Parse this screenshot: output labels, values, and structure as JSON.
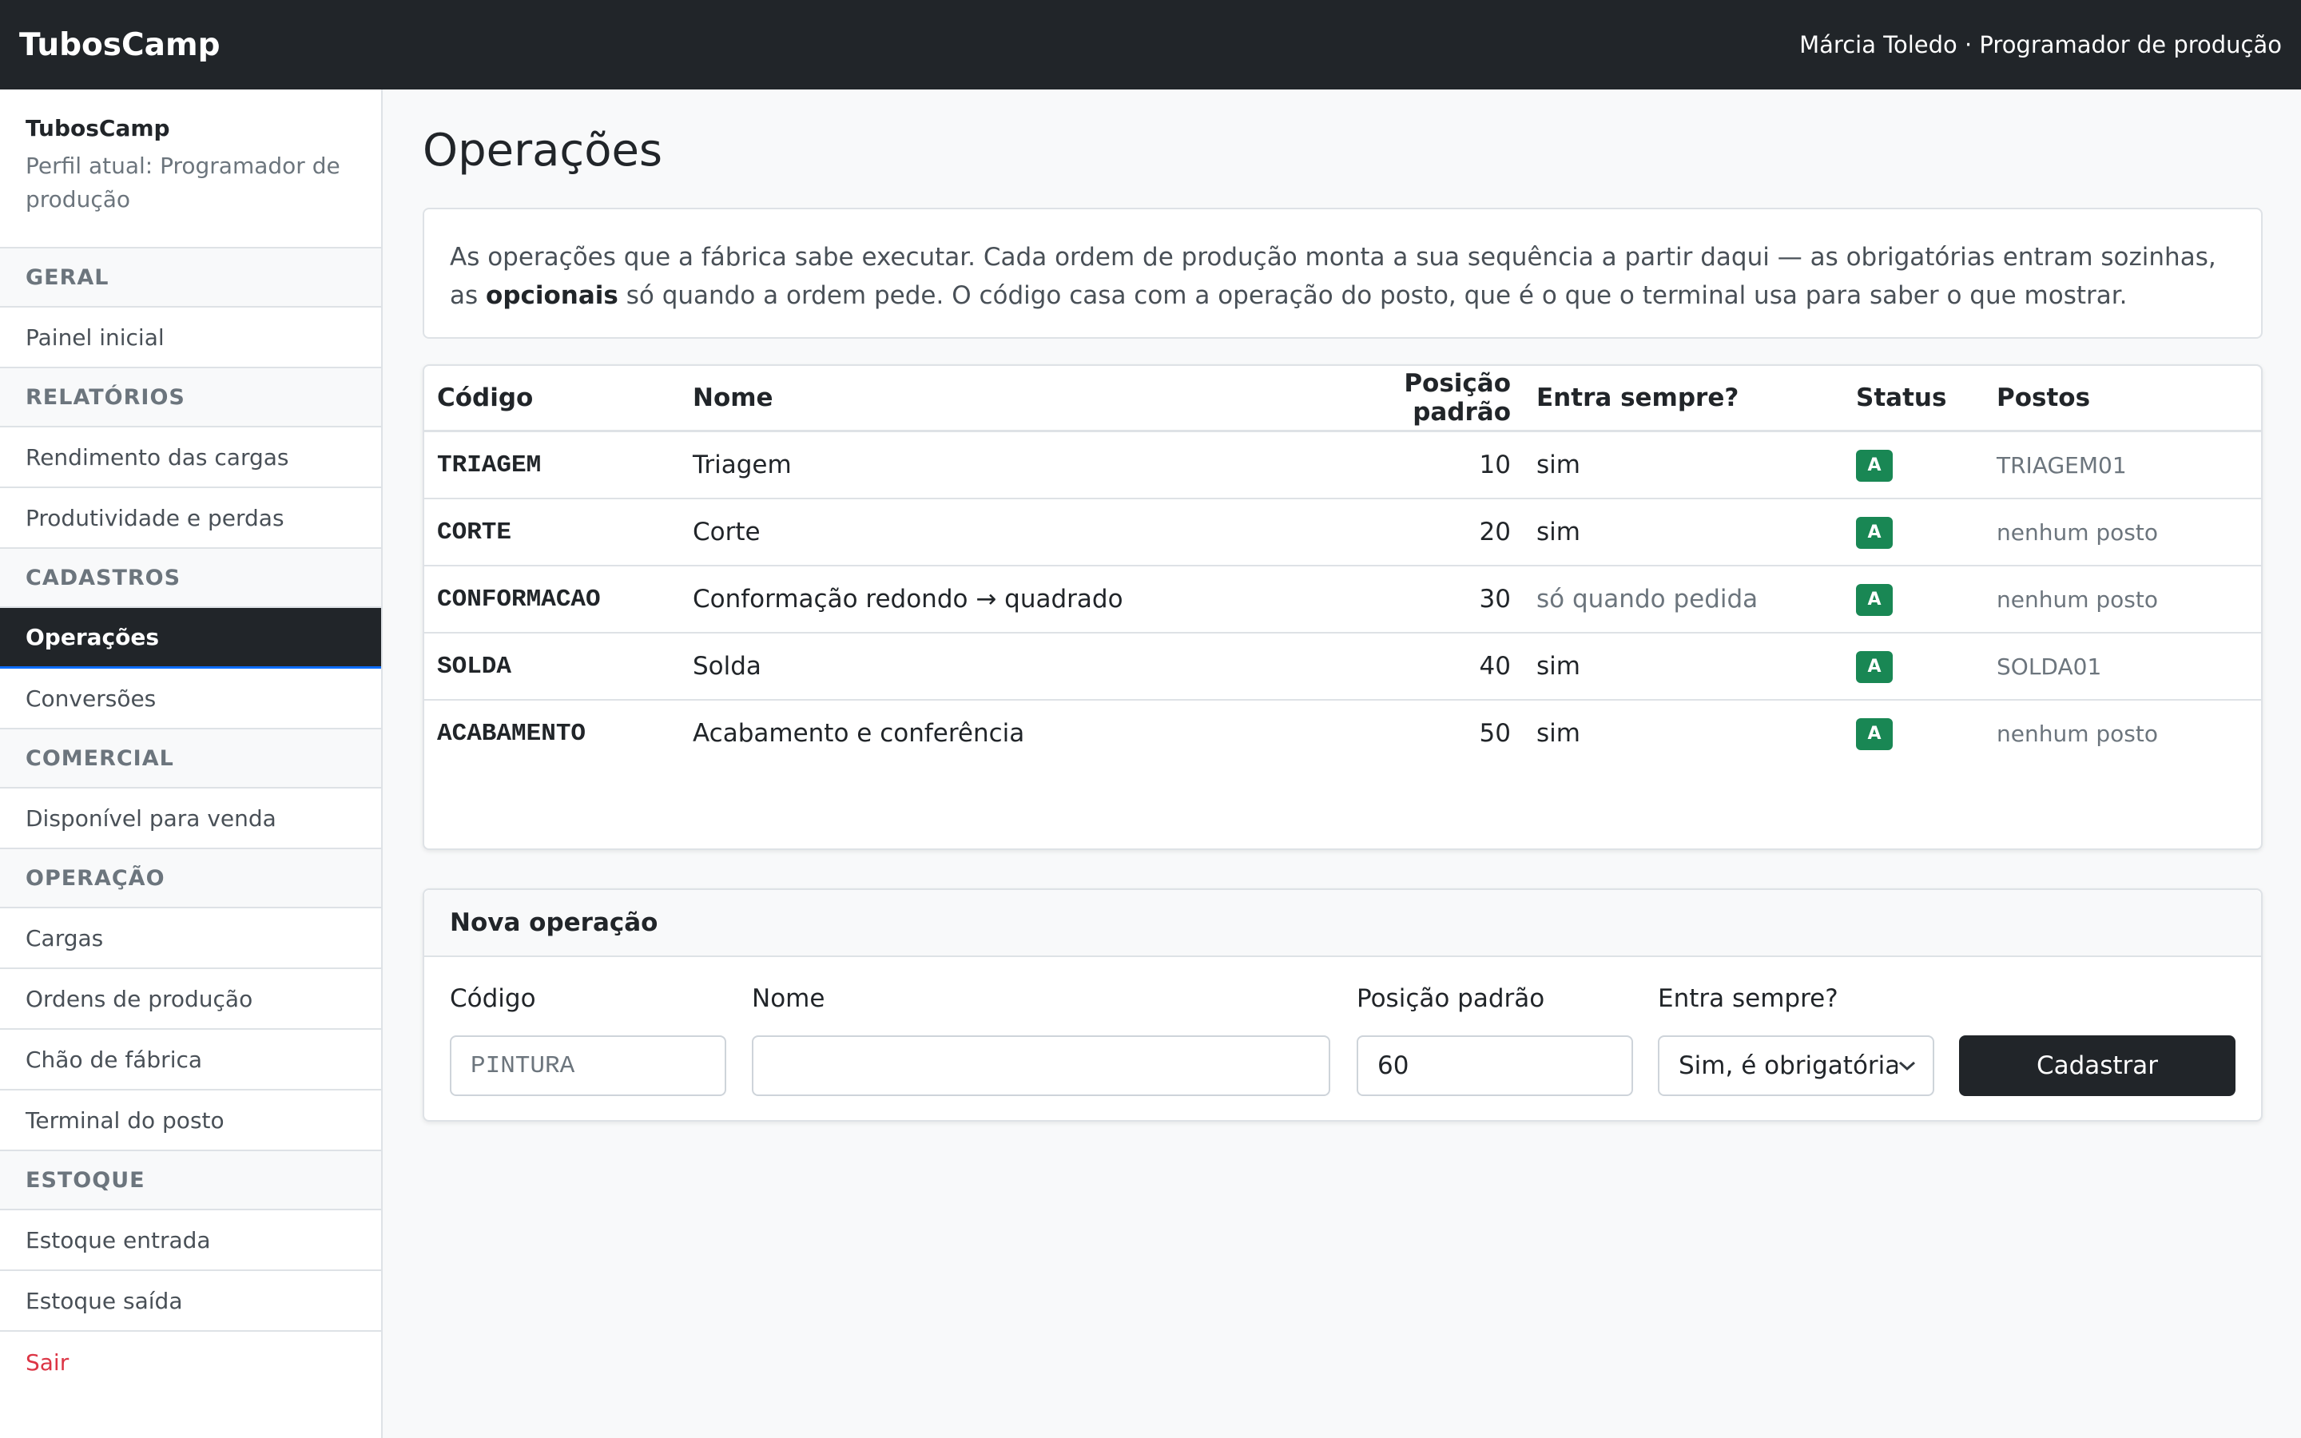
{
  "app": {
    "brand": "TubosCamp",
    "user": "Márcia Toledo · Programador de produção"
  },
  "sidebar": {
    "title": "TubosCamp",
    "subtitle": "Perfil atual: Programador de produção",
    "sections": [
      {
        "label": "GERAL",
        "items": [
          {
            "label": "Painel inicial"
          }
        ]
      },
      {
        "label": "RELATÓRIOS",
        "items": [
          {
            "label": "Rendimento das cargas"
          },
          {
            "label": "Produtividade e perdas"
          }
        ]
      },
      {
        "label": "CADASTROS",
        "items": [
          {
            "label": "Operações",
            "active": true
          },
          {
            "label": "Conversões"
          }
        ]
      },
      {
        "label": "COMERCIAL",
        "items": [
          {
            "label": "Disponível para venda"
          }
        ]
      },
      {
        "label": "OPERAÇÃO",
        "items": [
          {
            "label": "Cargas"
          },
          {
            "label": "Ordens de produção"
          },
          {
            "label": "Chão de fábrica"
          },
          {
            "label": "Terminal do posto"
          }
        ]
      },
      {
        "label": "ESTOQUE",
        "items": [
          {
            "label": "Estoque entrada"
          },
          {
            "label": "Estoque saída"
          }
        ]
      }
    ],
    "logout": "Sair"
  },
  "page": {
    "title": "Operações",
    "intro_1": "As operações que a fábrica sabe executar. Cada ordem de produção monta a sua sequência a partir daqui — as obrigatórias entram sozinhas, as ",
    "intro_bold": "opcionais",
    "intro_2": " só quando a ordem pede. O código casa com a operação do posto, que é o que o terminal usa para saber o que mostrar."
  },
  "table": {
    "headers": [
      "Código",
      "Nome",
      "Posição padrão",
      "Entra sempre?",
      "Status",
      "Postos"
    ],
    "rows": [
      {
        "codigo": "TRIAGEM",
        "nome": "Triagem",
        "posicao": "10",
        "entra": "sim",
        "status": "A",
        "postos": "TRIAGEM01"
      },
      {
        "codigo": "CORTE",
        "nome": "Corte",
        "posicao": "20",
        "entra": "sim",
        "status": "A",
        "postos": "nenhum posto"
      },
      {
        "codigo": "CONFORMACAO",
        "nome": "Conformação redondo → quadrado",
        "posicao": "30",
        "entra": "só quando pedida",
        "status": "A",
        "postos": "nenhum posto"
      },
      {
        "codigo": "SOLDA",
        "nome": "Solda",
        "posicao": "40",
        "entra": "sim",
        "status": "A",
        "postos": "SOLDA01"
      },
      {
        "codigo": "ACABAMENTO",
        "nome": "Acabamento e conferência",
        "posicao": "50",
        "entra": "sim",
        "status": "A",
        "postos": "nenhum posto"
      }
    ]
  },
  "form": {
    "title": "Nova operação",
    "codigo_label": "Código",
    "codigo_placeholder": "PINTURA",
    "nome_label": "Nome",
    "nome_value": "",
    "posicao_label": "Posição padrão",
    "posicao_value": "60",
    "entra_label": "Entra sempre?",
    "entra_value": "Sim, é obrigatória",
    "submit": "Cadastrar"
  },
  "colors": {
    "topbar": "#212529",
    "active_border": "#0d6efd",
    "badge": "#198754",
    "logout": "#dc3545"
  }
}
